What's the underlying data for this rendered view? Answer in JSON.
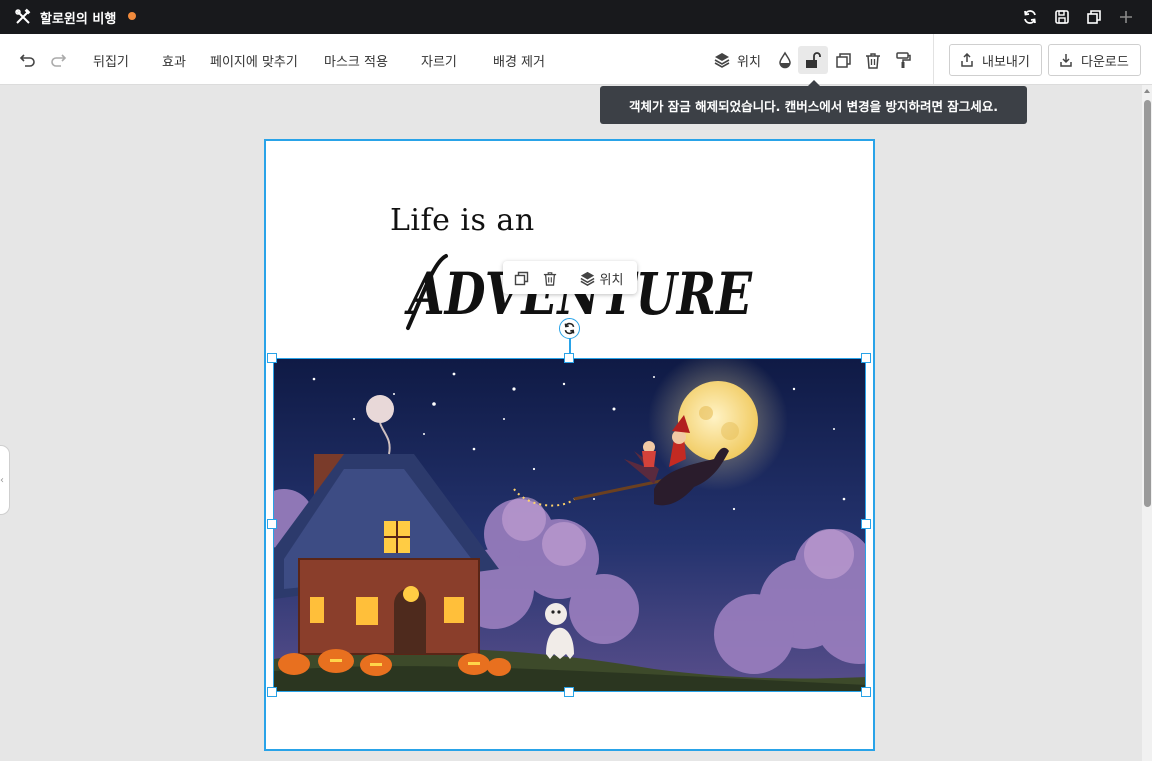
{
  "window": {
    "title": "할로윈의 비행",
    "icons": [
      "tools-icon",
      "sync-icon",
      "save-icon",
      "duplicate-page-icon",
      "plus-icon"
    ]
  },
  "toolbar": {
    "flip": "뒤집기",
    "effects": "효과",
    "fit_to_page": "페이지에 맞추기",
    "apply_mask": "마스크 적용",
    "crop": "자르기",
    "remove_bg": "배경 제거",
    "position": "위치",
    "export": "내보내기",
    "download": "다운로드"
  },
  "tooltip": {
    "text": "객체가 잠금 해제되었습니다. 캔버스에서 변경을 방지하려면 잠그세요."
  },
  "canvas": {
    "headline_line1": "Life is an",
    "headline_line2": "ADVENTURE",
    "float_toolbar_position": "위치",
    "image_alt": "Halloween night: witch and child flying on broom with dragon past full moon over cottage with jack-o-lanterns"
  },
  "colors": {
    "accent": "#29a3e8",
    "titlebar": "#18191c",
    "unsaved_dot": "#f08a3c",
    "tooltip_bg": "#3c4046"
  }
}
